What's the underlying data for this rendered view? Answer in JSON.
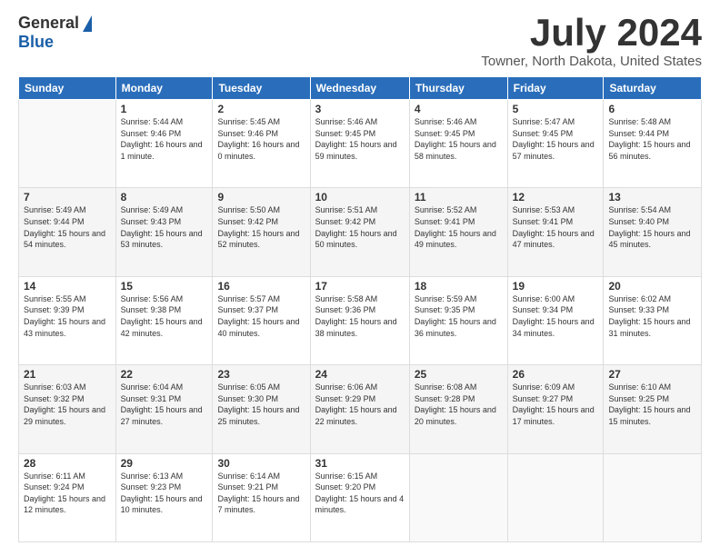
{
  "logo": {
    "general": "General",
    "blue": "Blue"
  },
  "title": {
    "month_year": "July 2024",
    "location": "Towner, North Dakota, United States"
  },
  "headers": [
    "Sunday",
    "Monday",
    "Tuesday",
    "Wednesday",
    "Thursday",
    "Friday",
    "Saturday"
  ],
  "weeks": [
    [
      {
        "day": "",
        "sunrise": "",
        "sunset": "",
        "daylight": ""
      },
      {
        "day": "1",
        "sunrise": "Sunrise: 5:44 AM",
        "sunset": "Sunset: 9:46 PM",
        "daylight": "Daylight: 16 hours and 1 minute."
      },
      {
        "day": "2",
        "sunrise": "Sunrise: 5:45 AM",
        "sunset": "Sunset: 9:46 PM",
        "daylight": "Daylight: 16 hours and 0 minutes."
      },
      {
        "day": "3",
        "sunrise": "Sunrise: 5:46 AM",
        "sunset": "Sunset: 9:45 PM",
        "daylight": "Daylight: 15 hours and 59 minutes."
      },
      {
        "day": "4",
        "sunrise": "Sunrise: 5:46 AM",
        "sunset": "Sunset: 9:45 PM",
        "daylight": "Daylight: 15 hours and 58 minutes."
      },
      {
        "day": "5",
        "sunrise": "Sunrise: 5:47 AM",
        "sunset": "Sunset: 9:45 PM",
        "daylight": "Daylight: 15 hours and 57 minutes."
      },
      {
        "day": "6",
        "sunrise": "Sunrise: 5:48 AM",
        "sunset": "Sunset: 9:44 PM",
        "daylight": "Daylight: 15 hours and 56 minutes."
      }
    ],
    [
      {
        "day": "7",
        "sunrise": "Sunrise: 5:49 AM",
        "sunset": "Sunset: 9:44 PM",
        "daylight": "Daylight: 15 hours and 54 minutes."
      },
      {
        "day": "8",
        "sunrise": "Sunrise: 5:49 AM",
        "sunset": "Sunset: 9:43 PM",
        "daylight": "Daylight: 15 hours and 53 minutes."
      },
      {
        "day": "9",
        "sunrise": "Sunrise: 5:50 AM",
        "sunset": "Sunset: 9:42 PM",
        "daylight": "Daylight: 15 hours and 52 minutes."
      },
      {
        "day": "10",
        "sunrise": "Sunrise: 5:51 AM",
        "sunset": "Sunset: 9:42 PM",
        "daylight": "Daylight: 15 hours and 50 minutes."
      },
      {
        "day": "11",
        "sunrise": "Sunrise: 5:52 AM",
        "sunset": "Sunset: 9:41 PM",
        "daylight": "Daylight: 15 hours and 49 minutes."
      },
      {
        "day": "12",
        "sunrise": "Sunrise: 5:53 AM",
        "sunset": "Sunset: 9:41 PM",
        "daylight": "Daylight: 15 hours and 47 minutes."
      },
      {
        "day": "13",
        "sunrise": "Sunrise: 5:54 AM",
        "sunset": "Sunset: 9:40 PM",
        "daylight": "Daylight: 15 hours and 45 minutes."
      }
    ],
    [
      {
        "day": "14",
        "sunrise": "Sunrise: 5:55 AM",
        "sunset": "Sunset: 9:39 PM",
        "daylight": "Daylight: 15 hours and 43 minutes."
      },
      {
        "day": "15",
        "sunrise": "Sunrise: 5:56 AM",
        "sunset": "Sunset: 9:38 PM",
        "daylight": "Daylight: 15 hours and 42 minutes."
      },
      {
        "day": "16",
        "sunrise": "Sunrise: 5:57 AM",
        "sunset": "Sunset: 9:37 PM",
        "daylight": "Daylight: 15 hours and 40 minutes."
      },
      {
        "day": "17",
        "sunrise": "Sunrise: 5:58 AM",
        "sunset": "Sunset: 9:36 PM",
        "daylight": "Daylight: 15 hours and 38 minutes."
      },
      {
        "day": "18",
        "sunrise": "Sunrise: 5:59 AM",
        "sunset": "Sunset: 9:35 PM",
        "daylight": "Daylight: 15 hours and 36 minutes."
      },
      {
        "day": "19",
        "sunrise": "Sunrise: 6:00 AM",
        "sunset": "Sunset: 9:34 PM",
        "daylight": "Daylight: 15 hours and 34 minutes."
      },
      {
        "day": "20",
        "sunrise": "Sunrise: 6:02 AM",
        "sunset": "Sunset: 9:33 PM",
        "daylight": "Daylight: 15 hours and 31 minutes."
      }
    ],
    [
      {
        "day": "21",
        "sunrise": "Sunrise: 6:03 AM",
        "sunset": "Sunset: 9:32 PM",
        "daylight": "Daylight: 15 hours and 29 minutes."
      },
      {
        "day": "22",
        "sunrise": "Sunrise: 6:04 AM",
        "sunset": "Sunset: 9:31 PM",
        "daylight": "Daylight: 15 hours and 27 minutes."
      },
      {
        "day": "23",
        "sunrise": "Sunrise: 6:05 AM",
        "sunset": "Sunset: 9:30 PM",
        "daylight": "Daylight: 15 hours and 25 minutes."
      },
      {
        "day": "24",
        "sunrise": "Sunrise: 6:06 AM",
        "sunset": "Sunset: 9:29 PM",
        "daylight": "Daylight: 15 hours and 22 minutes."
      },
      {
        "day": "25",
        "sunrise": "Sunrise: 6:08 AM",
        "sunset": "Sunset: 9:28 PM",
        "daylight": "Daylight: 15 hours and 20 minutes."
      },
      {
        "day": "26",
        "sunrise": "Sunrise: 6:09 AM",
        "sunset": "Sunset: 9:27 PM",
        "daylight": "Daylight: 15 hours and 17 minutes."
      },
      {
        "day": "27",
        "sunrise": "Sunrise: 6:10 AM",
        "sunset": "Sunset: 9:25 PM",
        "daylight": "Daylight: 15 hours and 15 minutes."
      }
    ],
    [
      {
        "day": "28",
        "sunrise": "Sunrise: 6:11 AM",
        "sunset": "Sunset: 9:24 PM",
        "daylight": "Daylight: 15 hours and 12 minutes."
      },
      {
        "day": "29",
        "sunrise": "Sunrise: 6:13 AM",
        "sunset": "Sunset: 9:23 PM",
        "daylight": "Daylight: 15 hours and 10 minutes."
      },
      {
        "day": "30",
        "sunrise": "Sunrise: 6:14 AM",
        "sunset": "Sunset: 9:21 PM",
        "daylight": "Daylight: 15 hours and 7 minutes."
      },
      {
        "day": "31",
        "sunrise": "Sunrise: 6:15 AM",
        "sunset": "Sunset: 9:20 PM",
        "daylight": "Daylight: 15 hours and 4 minutes."
      },
      {
        "day": "",
        "sunrise": "",
        "sunset": "",
        "daylight": ""
      },
      {
        "day": "",
        "sunrise": "",
        "sunset": "",
        "daylight": ""
      },
      {
        "day": "",
        "sunrise": "",
        "sunset": "",
        "daylight": ""
      }
    ]
  ]
}
